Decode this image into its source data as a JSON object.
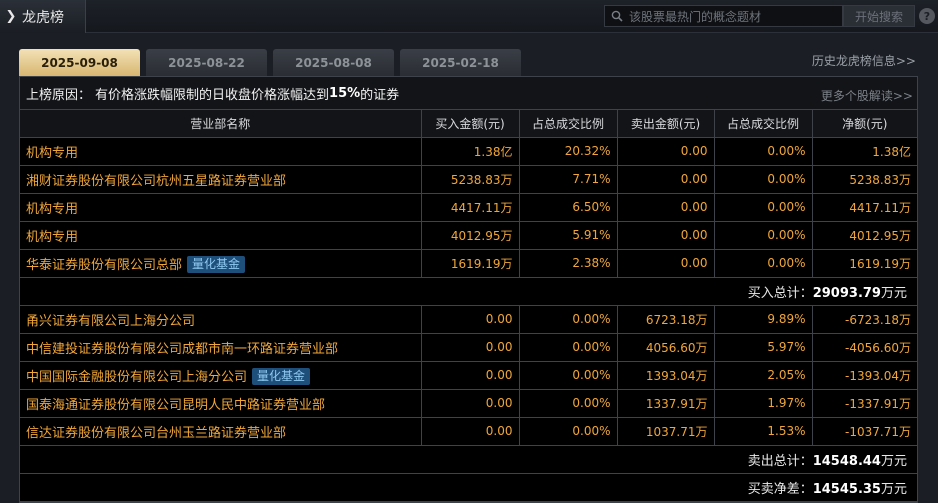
{
  "header": {
    "title": "龙虎榜",
    "search_placeholder": "该股票最热门的概念题材",
    "search_button": "开始搜索",
    "help": "?"
  },
  "tabs": [
    {
      "label": "2025-09-08",
      "active": true
    },
    {
      "label": "2025-08-22",
      "active": false
    },
    {
      "label": "2025-08-08",
      "active": false
    },
    {
      "label": "2025-02-18",
      "active": false
    }
  ],
  "history_link": "历史龙虎榜信息>>",
  "reason": {
    "prefix": "上榜原因：",
    "text_before": "有价格涨跌幅限制的日收盘价格涨幅达到",
    "highlight": "15%",
    "text_after": "的证券"
  },
  "more_link": "更多个股解读>>",
  "columns": [
    "营业部名称",
    "买入金额(元)",
    "占总成交比例",
    "卖出金额(元)",
    "占总成交比例",
    "净额(元)"
  ],
  "buy_rows": [
    {
      "name": "机构专用",
      "tag": "",
      "buy": "1.38亿",
      "buy_pct": "20.32%",
      "sell": "0.00",
      "sell_pct": "0.00%",
      "net": "1.38亿"
    },
    {
      "name": "湘财证券股份有限公司杭州五星路证券营业部",
      "tag": "",
      "buy": "5238.83万",
      "buy_pct": "7.71%",
      "sell": "0.00",
      "sell_pct": "0.00%",
      "net": "5238.83万"
    },
    {
      "name": "机构专用",
      "tag": "",
      "buy": "4417.11万",
      "buy_pct": "6.50%",
      "sell": "0.00",
      "sell_pct": "0.00%",
      "net": "4417.11万"
    },
    {
      "name": "机构专用",
      "tag": "",
      "buy": "4012.95万",
      "buy_pct": "5.91%",
      "sell": "0.00",
      "sell_pct": "0.00%",
      "net": "4012.95万"
    },
    {
      "name": "华泰证券股份有限公司总部",
      "tag": "量化基金",
      "buy": "1619.19万",
      "buy_pct": "2.38%",
      "sell": "0.00",
      "sell_pct": "0.00%",
      "net": "1619.19万"
    }
  ],
  "buy_total": {
    "label": "买入总计：",
    "value": "29093.79",
    "unit": "万元"
  },
  "sell_rows": [
    {
      "name": "甬兴证券有限公司上海分公司",
      "tag": "",
      "buy": "0.00",
      "buy_pct": "0.00%",
      "sell": "6723.18万",
      "sell_pct": "9.89%",
      "net": "-6723.18万"
    },
    {
      "name": "中信建投证券股份有限公司成都市南一环路证券营业部",
      "tag": "",
      "buy": "0.00",
      "buy_pct": "0.00%",
      "sell": "4056.60万",
      "sell_pct": "5.97%",
      "net": "-4056.60万"
    },
    {
      "name": "中国国际金融股份有限公司上海分公司",
      "tag": "量化基金",
      "buy": "0.00",
      "buy_pct": "0.00%",
      "sell": "1393.04万",
      "sell_pct": "2.05%",
      "net": "-1393.04万"
    },
    {
      "name": "国泰海通证券股份有限公司昆明人民中路证券营业部",
      "tag": "",
      "buy": "0.00",
      "buy_pct": "0.00%",
      "sell": "1337.91万",
      "sell_pct": "1.97%",
      "net": "-1337.91万"
    },
    {
      "name": "信达证券股份有限公司台州玉兰路证券营业部",
      "tag": "",
      "buy": "0.00",
      "buy_pct": "0.00%",
      "sell": "1037.71万",
      "sell_pct": "1.53%",
      "net": "-1037.71万"
    }
  ],
  "sell_total": {
    "label": "卖出总计：",
    "value": "14548.44",
    "unit": "万元"
  },
  "net_total": {
    "label": "买卖净差：",
    "value": "14545.35",
    "unit": "万元"
  }
}
